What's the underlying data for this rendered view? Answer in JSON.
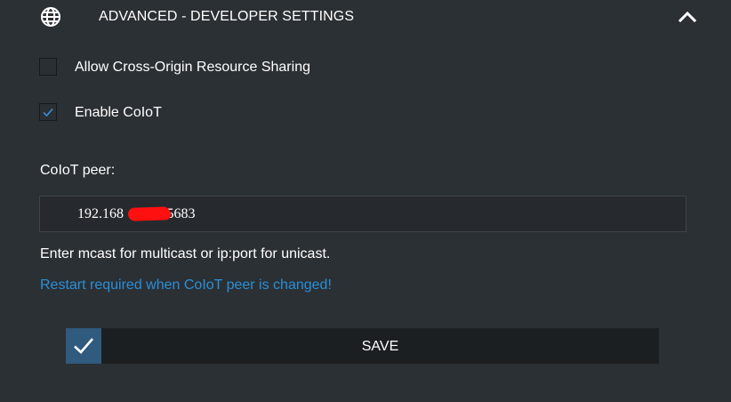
{
  "header": {
    "title": "ADVANCED - DEVELOPER SETTINGS",
    "icon": "globe-icon",
    "toggle_icon": "chevron-up-icon"
  },
  "options": [
    {
      "label": "Allow Cross-Origin Resource Sharing",
      "checked": false
    },
    {
      "label": "Enable CoIoT",
      "checked": true
    }
  ],
  "coiot_peer": {
    "label": "CoIoT peer:",
    "value": "192.168           :5683"
  },
  "hint": "Enter mcast for multicast or ip:port for unicast.",
  "restart_note": "Restart required when CoIoT peer is changed!",
  "save_button": {
    "label": "SAVE",
    "icon": "checkmark-icon"
  },
  "colors": {
    "background": "#2b3035",
    "accent_blue": "#2b8fd6",
    "save_icon_bg": "#305a7e",
    "button_bg": "#1c1f22"
  }
}
